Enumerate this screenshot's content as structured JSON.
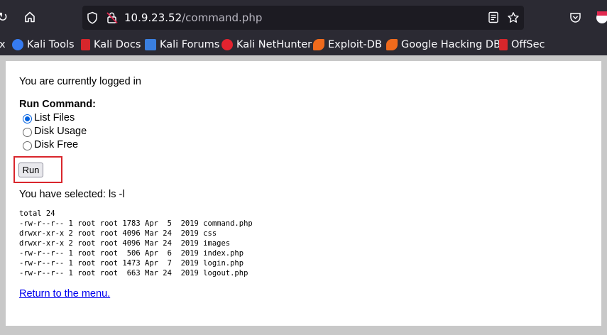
{
  "browser": {
    "url_host": "10.9.23.52",
    "url_path": "/command.php",
    "icons": [
      "reload-icon",
      "home-icon",
      "shield-icon",
      "lock-insecure-icon",
      "reader-view-icon",
      "bookmark-star-icon",
      "pocket-icon",
      "extensions-icon"
    ]
  },
  "bookmarks": [
    {
      "label": "x"
    },
    {
      "label": "Kali Tools"
    },
    {
      "label": "Kali Docs"
    },
    {
      "label": "Kali Forums"
    },
    {
      "label": "Kali NetHunter"
    },
    {
      "label": "Exploit-DB"
    },
    {
      "label": "Google Hacking DB"
    },
    {
      "label": "OffSec"
    }
  ],
  "page": {
    "status": "You are currently logged in",
    "form_label": "Run Command:",
    "options": [
      {
        "label": "List Files",
        "checked": true
      },
      {
        "label": "Disk Usage",
        "checked": false
      },
      {
        "label": "Disk Free",
        "checked": false
      }
    ],
    "run_label": "Run",
    "selected_text": "You have selected: ls -l",
    "output": "total 24\n-rw-r--r-- 1 root root 1783 Apr  5  2019 command.php\ndrwxr-xr-x 2 root root 4096 Mar 24  2019 css\ndrwxr-xr-x 2 root root 4096 Mar 24  2019 images\n-rw-r--r-- 1 root root  506 Apr  6  2019 index.php\n-rw-r--r-- 1 root root 1473 Apr  7  2019 login.php\n-rw-r--r-- 1 root root  663 Mar 24  2019 logout.php",
    "return_link": "Return to the menu."
  }
}
